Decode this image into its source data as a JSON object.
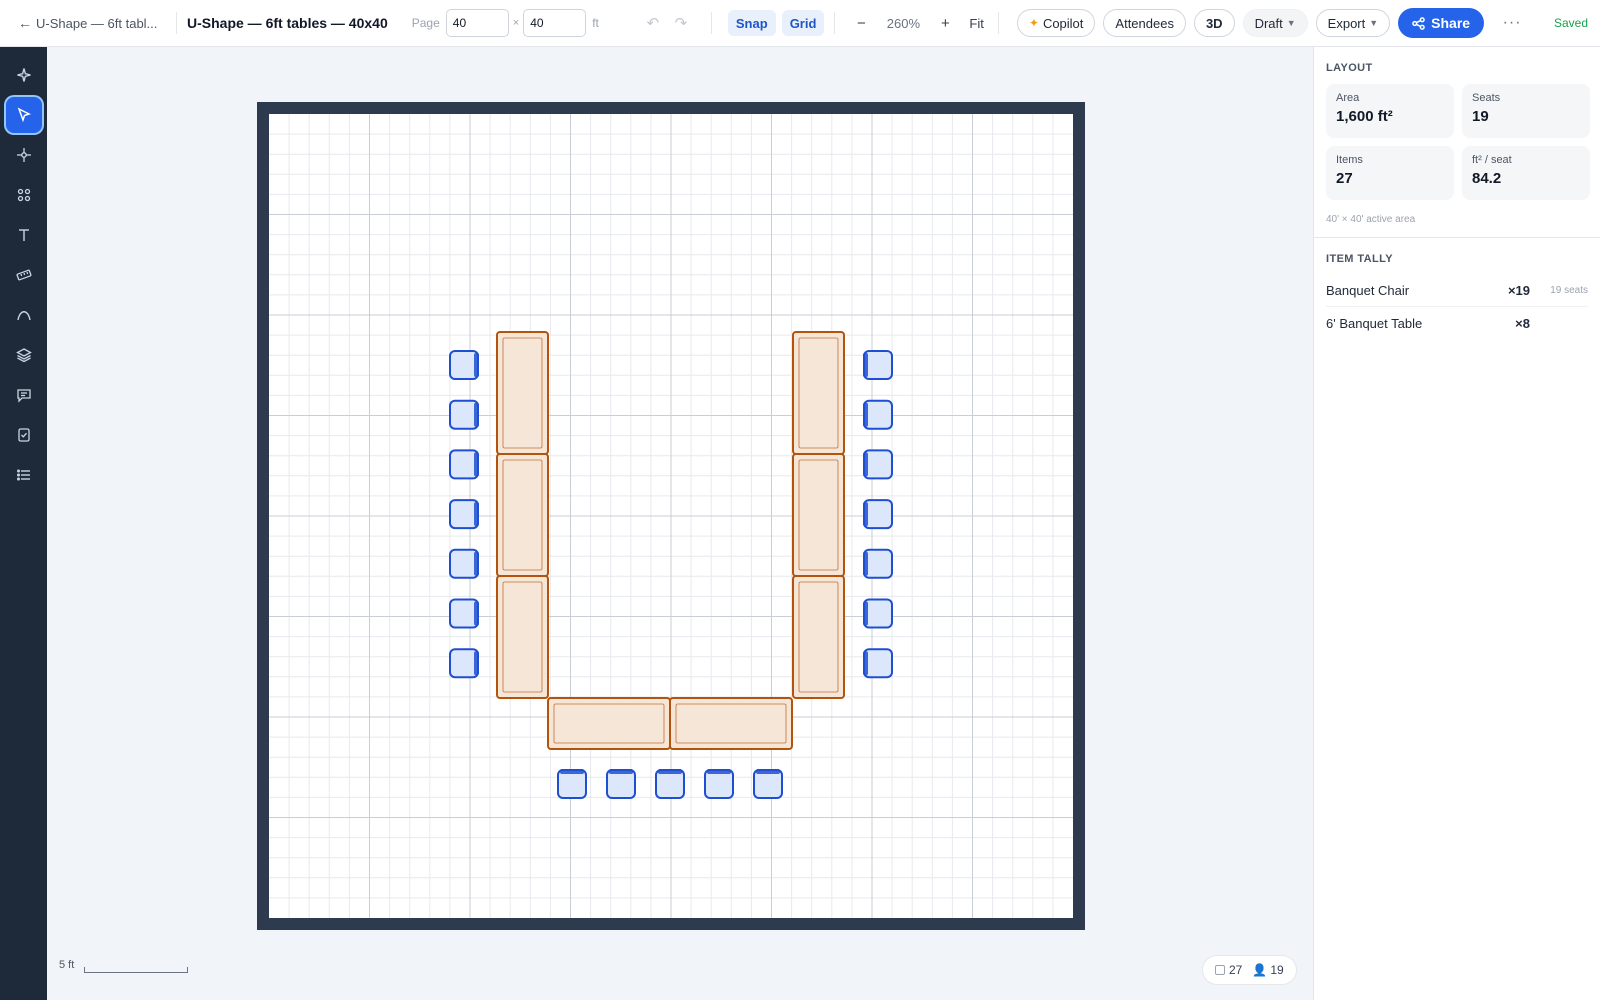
{
  "topbar": {
    "back_label": "U-Shape — 6ft tabl...",
    "title": "U-Shape — 6ft tables — 40x40",
    "page_label": "Page",
    "page_width": "40",
    "page_height": "40",
    "times": "×",
    "unit": "ft",
    "snap_label": "Snap",
    "grid_label": "Grid",
    "zoom_out": "−",
    "zoom_value": "260%",
    "zoom_in": "+",
    "fit_label": "Fit",
    "copilot_label": "Copilot",
    "attendees_label": "Attendees",
    "three_d_label": "3D",
    "draft_label": "Draft",
    "export_label": "Export",
    "share_label": "Share",
    "more_label": "···",
    "saved_label": "Saved"
  },
  "sidebar": {
    "tools": [
      {
        "icon": "sparkle-icon",
        "active": false
      },
      {
        "icon": "pointer-icon",
        "active": true
      },
      {
        "icon": "node-icon",
        "active": false
      },
      {
        "icon": "grid-dots-icon",
        "active": false
      },
      {
        "icon": "text-icon",
        "active": false
      },
      {
        "icon": "ruler-icon",
        "active": false
      },
      {
        "icon": "curve-icon",
        "active": false
      },
      {
        "icon": "layers-icon",
        "active": false
      },
      {
        "icon": "comment-icon",
        "active": false
      },
      {
        "icon": "checklist-icon",
        "active": false
      },
      {
        "icon": "list-icon",
        "active": false
      }
    ]
  },
  "canvas": {
    "grid_minor_ft": 1,
    "grid_major_ft": 5,
    "room_ft": [
      40,
      40
    ],
    "scale_label": "5 ft",
    "counts": {
      "items": "27",
      "seats": "19"
    },
    "colors": {
      "wall": "#2e3b4e",
      "grid_minor": "#e6e9ee",
      "grid_major": "#c9ced6",
      "table_fill": "#f6e6d8",
      "table_stroke": "#b4540c",
      "chair_fill": "#dde7fb",
      "chair_stroke": "#1f4fd1"
    }
  },
  "layout": {
    "section_title": "LAYOUT",
    "stats": [
      {
        "label": "Area",
        "value": "1,600 ft²"
      },
      {
        "label": "Seats",
        "value": "19"
      },
      {
        "label": "Items",
        "value": "27"
      },
      {
        "label": "ft² / seat",
        "value": "84.2"
      }
    ],
    "note": "40' × 40' active area"
  },
  "tally": {
    "section_title": "ITEM TALLY",
    "rows": [
      {
        "name": "Banquet Chair",
        "count": "×19",
        "seats": "19 seats"
      },
      {
        "name": "6' Banquet Table",
        "count": "×8",
        "seats": ""
      }
    ]
  }
}
